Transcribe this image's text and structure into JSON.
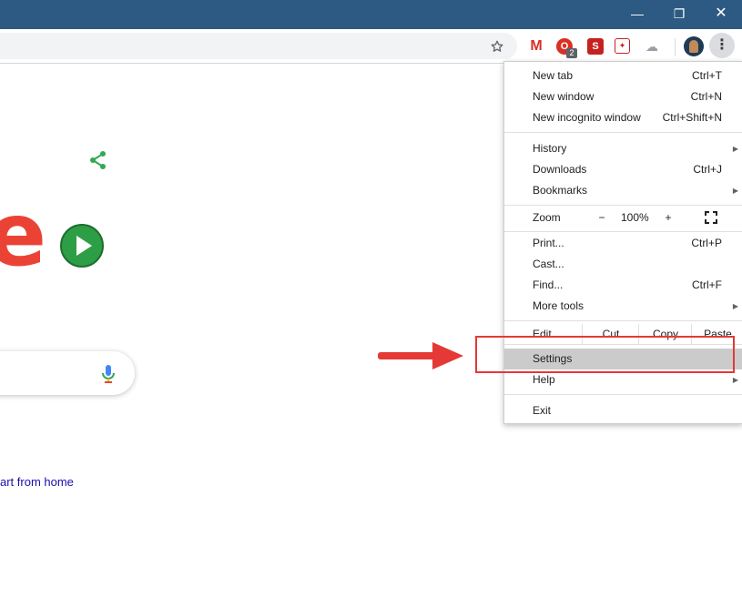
{
  "window": {
    "controls": [
      "—",
      "❐",
      "✕"
    ]
  },
  "toolbar": {
    "star_icon": "star-icon",
    "extensions": [
      {
        "name": "gmail-icon",
        "glyph": "M"
      },
      {
        "name": "opera-icon",
        "glyph": "O",
        "badge": "2"
      },
      {
        "name": "s-extension-icon",
        "glyph": "S"
      },
      {
        "name": "calendar-extension-icon",
        "glyph": "✦"
      },
      {
        "name": "cloud-icon",
        "glyph": "☁"
      }
    ],
    "menu_icon": "⋮"
  },
  "page": {
    "logo_fragment": "e",
    "home_link": "art from home"
  },
  "menu": {
    "items": [
      {
        "label": "New tab",
        "shortcut": "Ctrl+T"
      },
      {
        "label": "New window",
        "shortcut": "Ctrl+N"
      },
      {
        "label": "New incognito window",
        "shortcut": "Ctrl+Shift+N"
      },
      {
        "label": "History",
        "submenu": true
      },
      {
        "label": "Downloads",
        "shortcut": "Ctrl+J"
      },
      {
        "label": "Bookmarks",
        "submenu": true
      },
      {
        "label": "Print...",
        "shortcut": "Ctrl+P"
      },
      {
        "label": "Cast..."
      },
      {
        "label": "Find...",
        "shortcut": "Ctrl+F"
      },
      {
        "label": "More tools",
        "submenu": true
      },
      {
        "label": "Settings"
      },
      {
        "label": "Help",
        "submenu": true
      },
      {
        "label": "Exit"
      }
    ],
    "zoom": {
      "label": "Zoom",
      "minus": "−",
      "value": "100%",
      "plus": "+"
    },
    "edit": {
      "label": "Edit",
      "cut": "Cut",
      "copy": "Copy",
      "paste": "Paste"
    },
    "submenu_arrow": "▶"
  },
  "colors": {
    "titlebar": "#2c5a82",
    "highlight": "#e53935",
    "settings_hover": "#cbcbcb"
  }
}
